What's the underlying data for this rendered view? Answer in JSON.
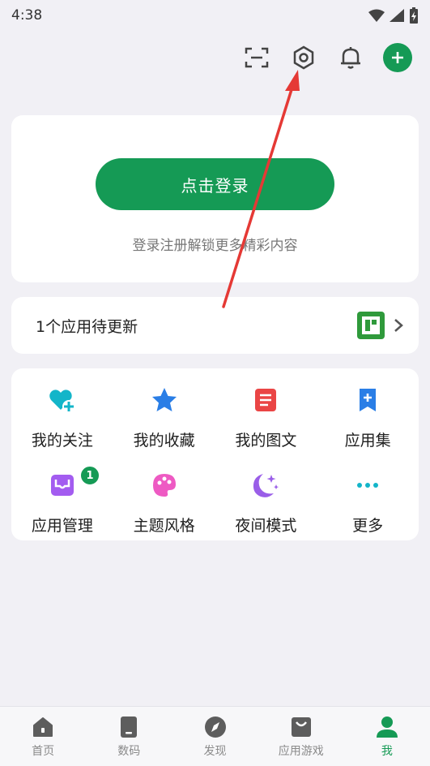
{
  "status": {
    "time": "4:38"
  },
  "login": {
    "button_label": "点击登录",
    "hint": "登录注册解锁更多精彩内容"
  },
  "update": {
    "text": "1个应用待更新"
  },
  "grid": {
    "items": [
      {
        "label": "我的关注",
        "icon": "heart-plus-icon",
        "color": "#13b5c9"
      },
      {
        "label": "我的收藏",
        "icon": "star-icon",
        "color": "#2a7ee6"
      },
      {
        "label": "我的图文",
        "icon": "document-icon",
        "color": "#ea4545"
      },
      {
        "label": "应用集",
        "icon": "bookmark-plus-icon",
        "color": "#2a7ee6"
      },
      {
        "label": "应用管理",
        "icon": "inbox-icon",
        "color": "#a35cf0",
        "badge": "1"
      },
      {
        "label": "主题风格",
        "icon": "palette-icon",
        "color": "#ee5ac3"
      },
      {
        "label": "夜间模式",
        "icon": "moon-stars-icon",
        "color": "#9a5ee8"
      },
      {
        "label": "更多",
        "icon": "more-dots-icon",
        "color": "#13b5c9"
      }
    ]
  },
  "nav": {
    "items": [
      {
        "label": "首页",
        "icon": "home-icon",
        "active": false
      },
      {
        "label": "数码",
        "icon": "phone-icon",
        "active": false
      },
      {
        "label": "发现",
        "icon": "compass-icon",
        "active": false
      },
      {
        "label": "应用游戏",
        "icon": "app-store-icon",
        "active": false
      },
      {
        "label": "我",
        "icon": "person-icon",
        "active": true
      }
    ]
  },
  "colors": {
    "accent": "#159a55",
    "background": "#f1f0f5",
    "annotation": "#e53935"
  }
}
